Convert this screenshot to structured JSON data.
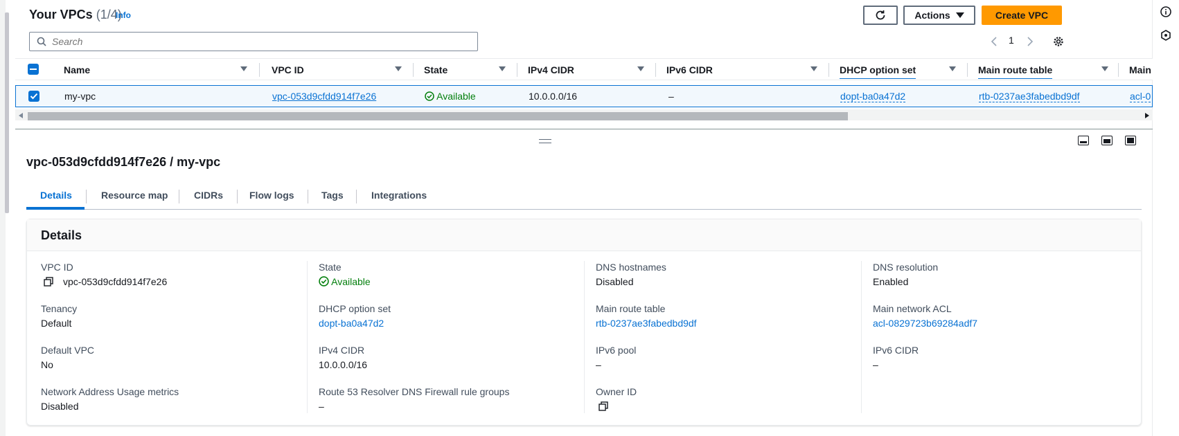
{
  "list": {
    "title": "Your VPCs",
    "count": "(1/4)",
    "info": "Info",
    "actions_label": "Actions",
    "create_label": "Create VPC",
    "search_placeholder": "Search",
    "page": "1",
    "columns": [
      "Name",
      "VPC ID",
      "State",
      "IPv4 CIDR",
      "IPv6 CIDR",
      "DHCP option set",
      "Main route table",
      "Main"
    ],
    "row": {
      "name": "my-vpc",
      "vpc_id": "vpc-053d9cfdd914f7e26",
      "state": "Available",
      "ipv4": "10.0.0.0/16",
      "ipv6": "–",
      "dhcp": "dopt-ba0a47d2",
      "route_table": "rtb-0237ae3fabedbd9df",
      "acl": "acl-0"
    }
  },
  "detail": {
    "title": "vpc-053d9cfdd914f7e26 / my-vpc",
    "tabs": [
      "Details",
      "Resource map",
      "CIDRs",
      "Flow logs",
      "Tags",
      "Integrations"
    ],
    "panel_title": "Details",
    "fields": {
      "vpc_id": {
        "label": "VPC ID",
        "value": "vpc-053d9cfdd914f7e26"
      },
      "state": {
        "label": "State",
        "value": "Available"
      },
      "dns_hostnames": {
        "label": "DNS hostnames",
        "value": "Disabled"
      },
      "dns_resolution": {
        "label": "DNS resolution",
        "value": "Enabled"
      },
      "tenancy": {
        "label": "Tenancy",
        "value": "Default"
      },
      "dhcp": {
        "label": "DHCP option set",
        "value": "dopt-ba0a47d2"
      },
      "route_table": {
        "label": "Main route table",
        "value": "rtb-0237ae3fabedbd9df"
      },
      "acl": {
        "label": "Main network ACL",
        "value": "acl-0829723b69284adf7"
      },
      "default_vpc": {
        "label": "Default VPC",
        "value": "No"
      },
      "ipv4": {
        "label": "IPv4 CIDR",
        "value": "10.0.0.0/16"
      },
      "ipv6_pool": {
        "label": "IPv6 pool",
        "value": "–"
      },
      "ipv6_cidr": {
        "label": "IPv6 CIDR",
        "value": "–"
      },
      "nau": {
        "label": "Network Address Usage metrics",
        "value": "Disabled"
      },
      "r53": {
        "label": "Route 53 Resolver DNS Firewall rule groups",
        "value": "–"
      },
      "owner": {
        "label": "Owner ID",
        "value": ""
      }
    }
  },
  "colors": {
    "accent": "#0972d3",
    "primary_button": "#ff9900",
    "success": "#037f0c"
  }
}
